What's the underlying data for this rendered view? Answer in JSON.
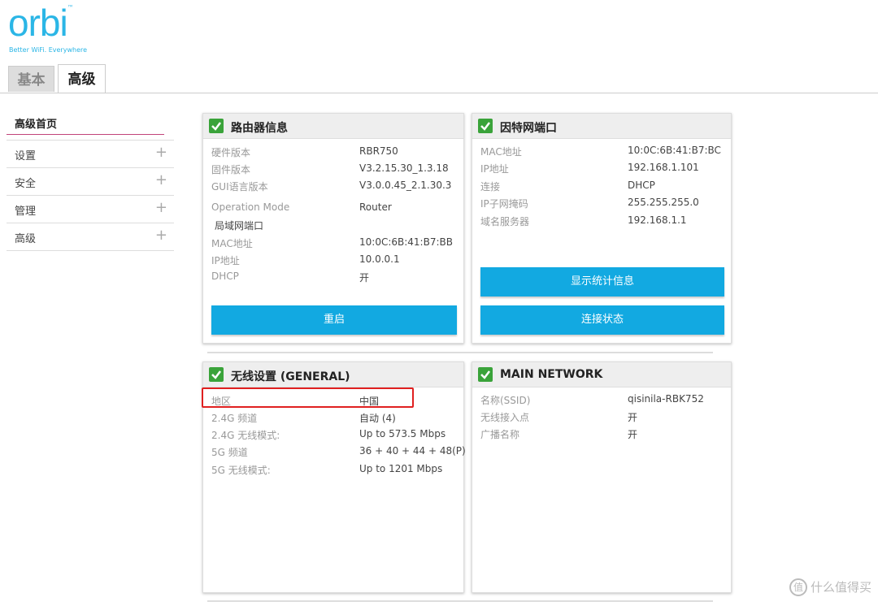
{
  "brand": {
    "logo": "orbi",
    "tm": "™",
    "tagline": "Better WiFi. Everywhere"
  },
  "tabs": [
    {
      "label": "基本"
    },
    {
      "label": "高级"
    }
  ],
  "sidebar": {
    "home": "高级首页",
    "items": [
      {
        "label": "设置"
      },
      {
        "label": "安全"
      },
      {
        "label": "管理"
      },
      {
        "label": "高级"
      }
    ],
    "expand_glyph": "+"
  },
  "router_info": {
    "title": "路由器信息",
    "rows": [
      {
        "k": "硬件版本",
        "v": "RBR750"
      },
      {
        "k": "固件版本",
        "v": "V3.2.15.30_1.3.18"
      },
      {
        "k": "GUI语言版本",
        "v": "V3.0.0.45_2.1.30.3"
      },
      {
        "k": "Operation Mode",
        "v": "Router"
      },
      {
        "k": "局域网端口",
        "v": ""
      },
      {
        "k": "MAC地址",
        "v": "10:0C:6B:41:B7:BB"
      },
      {
        "k": "IP地址",
        "v": "10.0.0.1"
      },
      {
        "k": "DHCP",
        "v": "开"
      }
    ],
    "button": "重启"
  },
  "internet_port": {
    "title": "因特网端口",
    "rows": [
      {
        "k": "MAC地址",
        "v": "10:0C:6B:41:B7:BC"
      },
      {
        "k": "IP地址",
        "v": "192.168.1.101"
      },
      {
        "k": "连接",
        "v": "DHCP"
      },
      {
        "k": "IP子网掩码",
        "v": "255.255.255.0"
      },
      {
        "k": "域名服务器",
        "v": "192.168.1.1"
      }
    ],
    "buttons": [
      "显示统计信息",
      "连接状态"
    ]
  },
  "wireless": {
    "title": "无线设置 (GENERAL)",
    "rows": [
      {
        "k": "地区",
        "v": "中国"
      },
      {
        "k": "2.4G 频道",
        "v": "自动 (4)"
      },
      {
        "k": "2.4G 无线模式:",
        "v": "Up to 573.5 Mbps"
      },
      {
        "k": "5G 频道",
        "v": "36 + 40 + 44 + 48(P)"
      },
      {
        "k": "5G 无线模式:",
        "v": "Up to 1201 Mbps"
      }
    ]
  },
  "main_network": {
    "title": "MAIN NETWORK",
    "rows": [
      {
        "k": "名称(SSID)",
        "v": "qisinila-RBK752"
      },
      {
        "k": "无线接入点",
        "v": "开"
      },
      {
        "k": "广播名称",
        "v": "开"
      }
    ]
  },
  "watermark": {
    "icon": "值",
    "text": "什么值得买"
  },
  "colors": {
    "brand": "#2bb6e6",
    "button": "#12a9e1",
    "check": "#3aa33a",
    "highlight": "#e02020"
  }
}
